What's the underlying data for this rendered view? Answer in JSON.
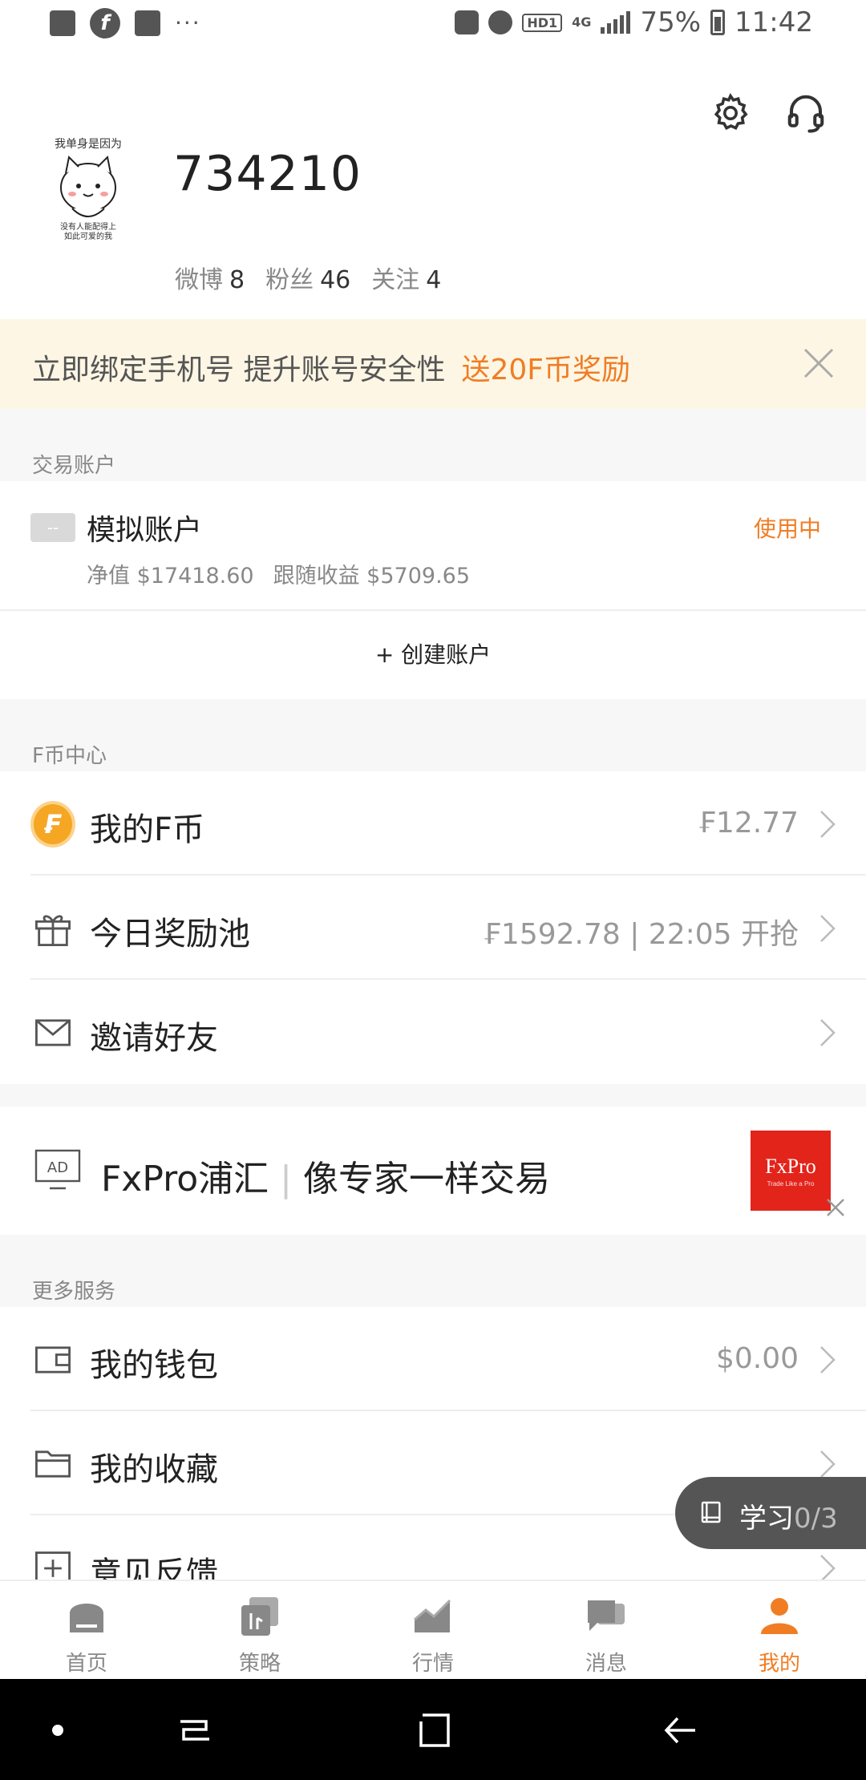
{
  "status_bar": {
    "battery": "75%",
    "time": "11:42",
    "network": "4G",
    "hd": "HD1",
    "dots": "···"
  },
  "profile": {
    "username": "734210",
    "stats": [
      {
        "label": "微博",
        "value": "8"
      },
      {
        "label": "粉丝",
        "value": "46"
      },
      {
        "label": "关注",
        "value": "4"
      }
    ]
  },
  "banner": {
    "text": "立即绑定手机号 提升账号安全性",
    "highlight": "送20F币奖励"
  },
  "trading": {
    "section_title": "交易账户",
    "account_tag": "--",
    "account_name": "模拟账户",
    "status": "使用中",
    "equity": "净值 $17418.60",
    "follow_profit": "跟随收益 $5709.65",
    "create_label": "+ 创建账户"
  },
  "fcoin": {
    "section_title": "F币中心",
    "items": [
      {
        "label": "我的F币",
        "value": "₣12.77",
        "icon": "coin-icon"
      },
      {
        "label": "今日奖励池",
        "value": "₣1592.78 | 22:05 开抢",
        "icon": "gift-icon"
      },
      {
        "label": "邀请好友",
        "value": "",
        "icon": "mail-icon"
      }
    ]
  },
  "ad": {
    "badge": "AD",
    "title": "FxPro浦汇",
    "subtitle": "像专家一样交易",
    "logo_text": "FxPro",
    "logo_tagline": "Trade Like a Pro"
  },
  "services": {
    "section_title": "更多服务",
    "items": [
      {
        "label": "我的钱包",
        "value": "$0.00",
        "icon": "wallet-icon"
      },
      {
        "label": "我的收藏",
        "value": "",
        "icon": "folder-icon"
      },
      {
        "label": "意见反馈",
        "value": "",
        "icon": "feedback-icon"
      }
    ]
  },
  "study": {
    "label": "学习",
    "count": "0/3"
  },
  "tabs": [
    {
      "label": "首页",
      "icon": "home-icon",
      "active": false
    },
    {
      "label": "策略",
      "icon": "strategy-icon",
      "active": false
    },
    {
      "label": "行情",
      "icon": "market-icon",
      "active": false
    },
    {
      "label": "消息",
      "icon": "message-icon",
      "active": false
    },
    {
      "label": "我的",
      "icon": "profile-icon",
      "active": true
    }
  ],
  "colors": {
    "accent": "#f07d24",
    "banner_bg": "#fdf6e4",
    "section_bg": "#f7f7f7"
  }
}
